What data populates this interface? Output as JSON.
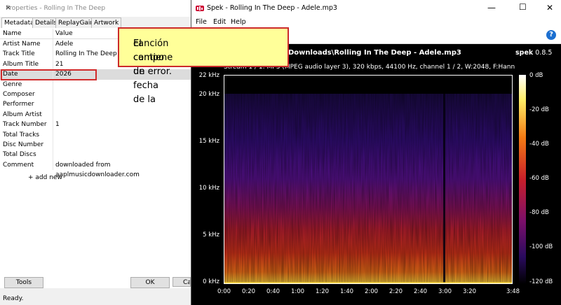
{
  "props": {
    "title": "Properties - Rolling In The Deep",
    "tabs": [
      "Metadata",
      "Details",
      "ReplayGain",
      "Artwork"
    ],
    "col_name": "Name",
    "col_value": "Value",
    "rows": [
      {
        "name": "Artist Name",
        "value": "Adele"
      },
      {
        "name": "Track Title",
        "value": "Rolling In The Deep"
      },
      {
        "name": "Album Title",
        "value": "21"
      },
      {
        "name": "Date",
        "value": "2026"
      },
      {
        "name": "Genre",
        "value": ""
      },
      {
        "name": "Composer",
        "value": ""
      },
      {
        "name": "Performer",
        "value": ""
      },
      {
        "name": "Album Artist",
        "value": ""
      },
      {
        "name": "Track Number",
        "value": "1"
      },
      {
        "name": "Total Tracks",
        "value": ""
      },
      {
        "name": "Disc Number",
        "value": ""
      },
      {
        "name": "Total Discs",
        "value": ""
      },
      {
        "name": "Comment",
        "value": "downloaded from aaplmusicdownloader.com"
      }
    ],
    "add_new": "+ add new",
    "tools_btn": "Tools",
    "ok_btn": "OK",
    "cancel_btn": "Ca",
    "status": "Ready."
  },
  "spek": {
    "title": "Spek - Rolling In The Deep - Adele.mp3",
    "menu": [
      "File",
      "Edit",
      "Help"
    ],
    "file_path": "Downloads\\Rolling In The Deep - Adele.mp3",
    "version_name": "spek",
    "version_num": "0.8.5",
    "stream_info": "Stream 1 / 1: MP3 (MPEG audio layer 3), 320 kbps, 44100 Hz, channel 1 / 2, W:2048, F:Hann",
    "freq_labels": [
      "22 kHz",
      "20 kHz",
      "15 kHz",
      "10 kHz",
      "5 kHz",
      "0 kHz"
    ],
    "time_labels": [
      "0:00",
      "0:20",
      "0:40",
      "1:00",
      "1:20",
      "1:40",
      "2:00",
      "2:20",
      "2:40",
      "3:00",
      "3:20",
      "3:48"
    ],
    "db_labels": [
      "0 dB",
      "-20 dB",
      "-40 dB",
      "-60 dB",
      "-80 dB",
      "-100 dB",
      "-120 dB"
    ]
  },
  "callout": {
    "line1": "El campo de fecha de la",
    "line2": "canción contiene un error."
  },
  "colors": {
    "callout_bg": "#ffff99",
    "callout_border": "#cc2a2a",
    "highlight": "#d12b2b"
  }
}
